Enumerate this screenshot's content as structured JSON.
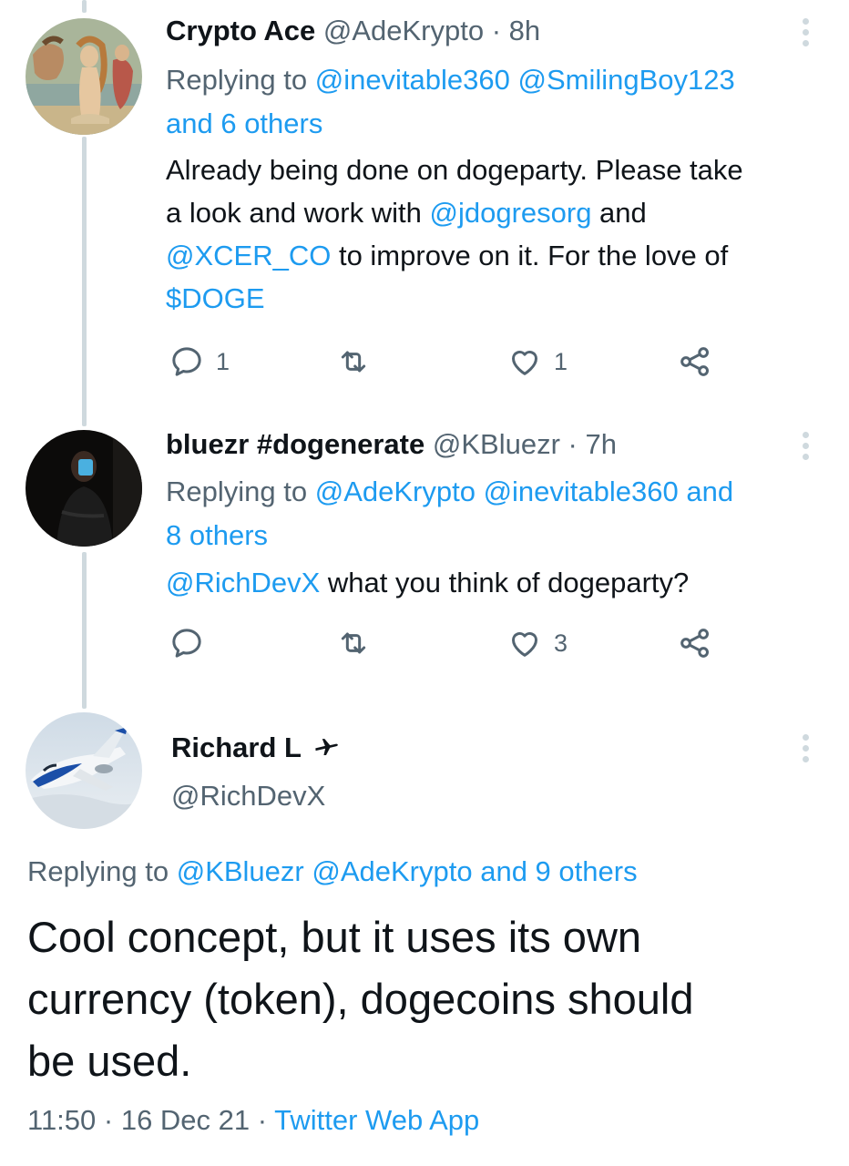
{
  "tweet1": {
    "name": "Crypto Ace",
    "handle": "@AdeKrypto",
    "sep": " · ",
    "time": "8h",
    "replying_prefix": "Replying to ",
    "replying_mention1": "@inevitable360",
    "replying_mention2": "@SmilingBoy123",
    "replying_others": "and 6 others",
    "text_1": "Already being done on dogeparty. Please take",
    "text_2a": "a look and work with ",
    "text_2_mention": "@jdogresorg",
    "text_2b": " and",
    "text_3_mention": "@XCER_CO",
    "text_3b": " to improve on it. For the love of",
    "text_4_cashtag": "$DOGE",
    "reply_count": "1",
    "like_count": "1",
    "avatar_icon": "renaissance-painting-avatar"
  },
  "tweet2": {
    "name": "bluezr #dogenerate",
    "handle": "@KBluezr",
    "sep": " · ",
    "time": "7h",
    "replying_prefix": "Replying to ",
    "replying_mention1": "@AdeKrypto",
    "replying_mention2": "@inevitable360",
    "replying_and": "and",
    "replying_others": "8 others",
    "text_mention": "@RichDevX",
    "text_rest": " what you think of dogeparty?",
    "reply_count": "",
    "like_count": "3",
    "avatar_icon": "masked-person-avatar"
  },
  "main_tweet": {
    "name": "Richard L",
    "name_icon": "airplane-icon",
    "handle": "@RichDevX",
    "replying_prefix": "Replying to ",
    "replying_mention1": "@KBluezr",
    "replying_mention2": "@AdeKrypto",
    "replying_others": "and 9 others",
    "text_1": "Cool concept, but it uses its own",
    "text_2": "currency (token), dogecoins should",
    "text_3": "be used.",
    "timestamp": "11:50 · 16 Dec 21 · ",
    "source": "Twitter Web App",
    "avatar_icon": "jet-airplane-avatar"
  },
  "colors": {
    "link": "#1d9bf0",
    "muted": "#536471",
    "text": "#0f1419",
    "thread_line": "#cfd9de"
  }
}
